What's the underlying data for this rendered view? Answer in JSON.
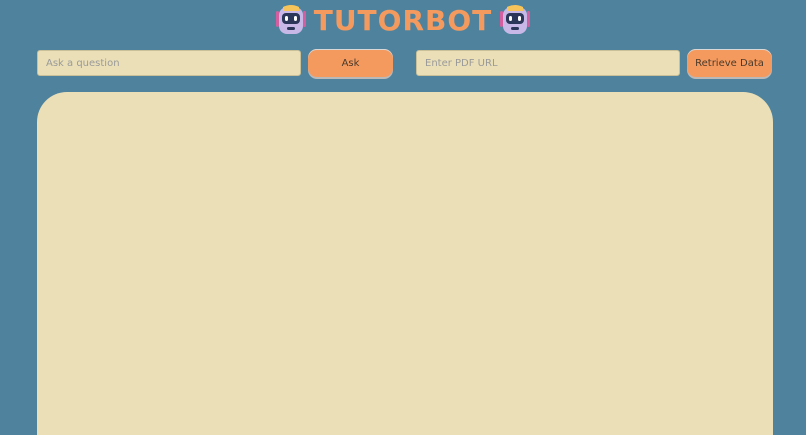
{
  "header": {
    "title": "TUTORBOT",
    "icon_left": "robot-icon",
    "icon_right": "robot-icon"
  },
  "question": {
    "placeholder": "Ask a question",
    "value": "",
    "button_label": "Ask"
  },
  "pdf": {
    "placeholder": "Enter PDF URL",
    "value": "",
    "button_label": "Retrieve Data"
  },
  "colors": {
    "background": "#4f839d",
    "accent": "#f49a5f",
    "panel": "#eadfb7"
  }
}
